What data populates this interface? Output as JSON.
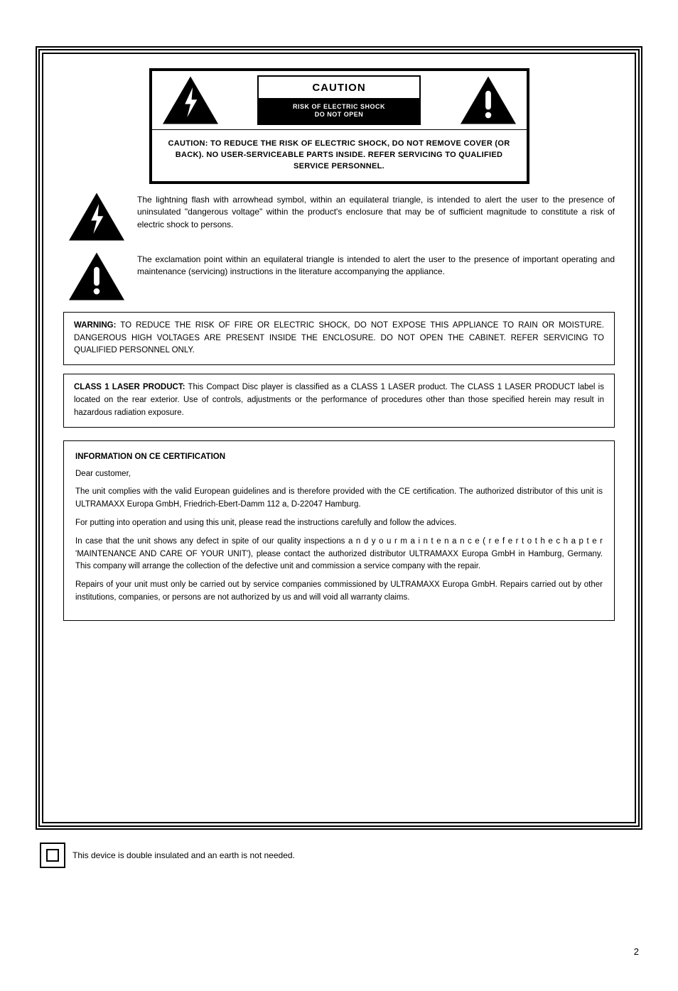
{
  "cautionBox": {
    "topLabel": "CAUTION",
    "bottomBlackLine1": "RISK OF ELECTRIC SHOCK",
    "bottomBlackLine2": "DO NOT OPEN",
    "lowerText": "CAUTION: TO REDUCE THE RISK OF ELECTRIC SHOCK, DO NOT REMOVE COVER (OR BACK). NO USER-SERVICEABLE PARTS INSIDE. REFER SERVICING TO QUALIFIED SERVICE PERSONNEL."
  },
  "iconLightning": "lightning-triangle-icon",
  "iconExclaim": "exclamation-triangle-icon",
  "symbolDescriptions": {
    "lightning": "The lightning flash with arrowhead symbol, within an equilateral triangle, is intended to alert the user to the presence of uninsulated \"dangerous voltage\" within the product's enclosure that may be of sufficient magnitude to constitute a risk of electric shock to persons.",
    "exclamation": "The exclamation point within an equilateral triangle is intended to alert the user to the presence of important operating and maintenance (servicing) instructions in the literature accompanying the appliance."
  },
  "warningBox": {
    "lead": "WARNING:",
    "text": " TO REDUCE THE RISK OF FIRE OR ELECTRIC SHOCK, DO NOT EXPOSE THIS APPLIANCE TO RAIN OR MOISTURE. DANGEROUS HIGH VOLTAGES ARE PRESENT INSIDE THE ENCLOSURE. DO NOT OPEN THE CABINET. REFER SERVICING TO QUALIFIED PERSONNEL ONLY."
  },
  "laserBox": {
    "lead": "CLASS 1 LASER PRODUCT:",
    "text": " This Compact Disc player is classified as a CLASS 1 LASER product. The CLASS 1 LASER PRODUCT label is located on the rear exterior. Use of controls, adjustments or the performance of procedures other than those specified herein may result in hazardous radiation exposure."
  },
  "ceBox": {
    "title": "INFORMATION ON CE CERTIFICATION",
    "para1": "Dear customer,",
    "para2": "The unit complies with the valid European guidelines and is therefore provided with the CE certification. The authorized distributor of this unit is ULTRAMAXX Europa GmbH, Friedrich-Ebert-Damm 112 a, D-22047 Hamburg.",
    "para3": "For putting into operation and using this unit, please read the instructions carefully and follow the advices.",
    "para4": "In case that the unit shows any defect in spite of our quality inspections a n d  y o u r  m a i n t e n a n c e  ( r e f e r  t o  t h e  c h a p t e r  'MAINTENANCE AND CARE OF YOUR UNIT'), please contact the authorized distributor ULTRAMAXX Europa GmbH in Hamburg, Germany. This company will arrange the collection of the defective unit and commission a service company with the repair.",
    "para5": "Repairs of your unit must only be carried out by service companies commissioned by ULTRAMAXX Europa GmbH. Repairs carried out by other institutions, companies, or persons are not authorized by us and will void all warranty claims."
  },
  "footer": {
    "text": "This device is double insulated and an earth is not needed.",
    "iconName": "double-insulation-icon"
  },
  "pageNumber": "2"
}
